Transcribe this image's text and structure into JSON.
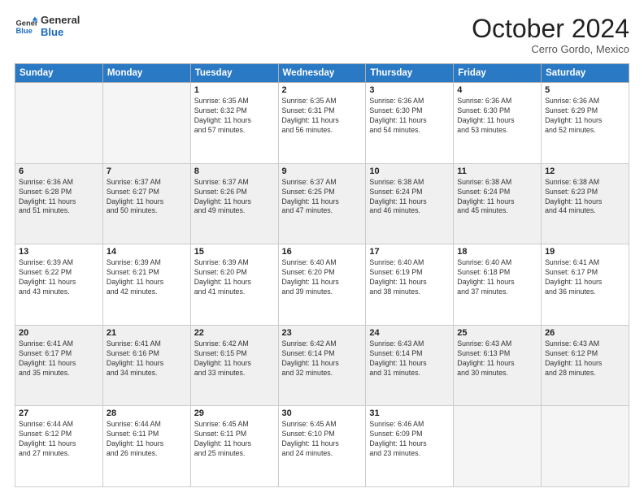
{
  "logo": {
    "line1": "General",
    "line2": "Blue"
  },
  "title": "October 2024",
  "location": "Cerro Gordo, Mexico",
  "days_of_week": [
    "Sunday",
    "Monday",
    "Tuesday",
    "Wednesday",
    "Thursday",
    "Friday",
    "Saturday"
  ],
  "weeks": [
    [
      {
        "num": "",
        "sunrise": "",
        "sunset": "",
        "daylight": ""
      },
      {
        "num": "",
        "sunrise": "",
        "sunset": "",
        "daylight": ""
      },
      {
        "num": "1",
        "sunrise": "Sunrise: 6:35 AM",
        "sunset": "Sunset: 6:32 PM",
        "daylight": "Daylight: 11 hours and 57 minutes."
      },
      {
        "num": "2",
        "sunrise": "Sunrise: 6:35 AM",
        "sunset": "Sunset: 6:31 PM",
        "daylight": "Daylight: 11 hours and 56 minutes."
      },
      {
        "num": "3",
        "sunrise": "Sunrise: 6:36 AM",
        "sunset": "Sunset: 6:30 PM",
        "daylight": "Daylight: 11 hours and 54 minutes."
      },
      {
        "num": "4",
        "sunrise": "Sunrise: 6:36 AM",
        "sunset": "Sunset: 6:30 PM",
        "daylight": "Daylight: 11 hours and 53 minutes."
      },
      {
        "num": "5",
        "sunrise": "Sunrise: 6:36 AM",
        "sunset": "Sunset: 6:29 PM",
        "daylight": "Daylight: 11 hours and 52 minutes."
      }
    ],
    [
      {
        "num": "6",
        "sunrise": "Sunrise: 6:36 AM",
        "sunset": "Sunset: 6:28 PM",
        "daylight": "Daylight: 11 hours and 51 minutes."
      },
      {
        "num": "7",
        "sunrise": "Sunrise: 6:37 AM",
        "sunset": "Sunset: 6:27 PM",
        "daylight": "Daylight: 11 hours and 50 minutes."
      },
      {
        "num": "8",
        "sunrise": "Sunrise: 6:37 AM",
        "sunset": "Sunset: 6:26 PM",
        "daylight": "Daylight: 11 hours and 49 minutes."
      },
      {
        "num": "9",
        "sunrise": "Sunrise: 6:37 AM",
        "sunset": "Sunset: 6:25 PM",
        "daylight": "Daylight: 11 hours and 47 minutes."
      },
      {
        "num": "10",
        "sunrise": "Sunrise: 6:38 AM",
        "sunset": "Sunset: 6:24 PM",
        "daylight": "Daylight: 11 hours and 46 minutes."
      },
      {
        "num": "11",
        "sunrise": "Sunrise: 6:38 AM",
        "sunset": "Sunset: 6:24 PM",
        "daylight": "Daylight: 11 hours and 45 minutes."
      },
      {
        "num": "12",
        "sunrise": "Sunrise: 6:38 AM",
        "sunset": "Sunset: 6:23 PM",
        "daylight": "Daylight: 11 hours and 44 minutes."
      }
    ],
    [
      {
        "num": "13",
        "sunrise": "Sunrise: 6:39 AM",
        "sunset": "Sunset: 6:22 PM",
        "daylight": "Daylight: 11 hours and 43 minutes."
      },
      {
        "num": "14",
        "sunrise": "Sunrise: 6:39 AM",
        "sunset": "Sunset: 6:21 PM",
        "daylight": "Daylight: 11 hours and 42 minutes."
      },
      {
        "num": "15",
        "sunrise": "Sunrise: 6:39 AM",
        "sunset": "Sunset: 6:20 PM",
        "daylight": "Daylight: 11 hours and 41 minutes."
      },
      {
        "num": "16",
        "sunrise": "Sunrise: 6:40 AM",
        "sunset": "Sunset: 6:20 PM",
        "daylight": "Daylight: 11 hours and 39 minutes."
      },
      {
        "num": "17",
        "sunrise": "Sunrise: 6:40 AM",
        "sunset": "Sunset: 6:19 PM",
        "daylight": "Daylight: 11 hours and 38 minutes."
      },
      {
        "num": "18",
        "sunrise": "Sunrise: 6:40 AM",
        "sunset": "Sunset: 6:18 PM",
        "daylight": "Daylight: 11 hours and 37 minutes."
      },
      {
        "num": "19",
        "sunrise": "Sunrise: 6:41 AM",
        "sunset": "Sunset: 6:17 PM",
        "daylight": "Daylight: 11 hours and 36 minutes."
      }
    ],
    [
      {
        "num": "20",
        "sunrise": "Sunrise: 6:41 AM",
        "sunset": "Sunset: 6:17 PM",
        "daylight": "Daylight: 11 hours and 35 minutes."
      },
      {
        "num": "21",
        "sunrise": "Sunrise: 6:41 AM",
        "sunset": "Sunset: 6:16 PM",
        "daylight": "Daylight: 11 hours and 34 minutes."
      },
      {
        "num": "22",
        "sunrise": "Sunrise: 6:42 AM",
        "sunset": "Sunset: 6:15 PM",
        "daylight": "Daylight: 11 hours and 33 minutes."
      },
      {
        "num": "23",
        "sunrise": "Sunrise: 6:42 AM",
        "sunset": "Sunset: 6:14 PM",
        "daylight": "Daylight: 11 hours and 32 minutes."
      },
      {
        "num": "24",
        "sunrise": "Sunrise: 6:43 AM",
        "sunset": "Sunset: 6:14 PM",
        "daylight": "Daylight: 11 hours and 31 minutes."
      },
      {
        "num": "25",
        "sunrise": "Sunrise: 6:43 AM",
        "sunset": "Sunset: 6:13 PM",
        "daylight": "Daylight: 11 hours and 30 minutes."
      },
      {
        "num": "26",
        "sunrise": "Sunrise: 6:43 AM",
        "sunset": "Sunset: 6:12 PM",
        "daylight": "Daylight: 11 hours and 28 minutes."
      }
    ],
    [
      {
        "num": "27",
        "sunrise": "Sunrise: 6:44 AM",
        "sunset": "Sunset: 6:12 PM",
        "daylight": "Daylight: 11 hours and 27 minutes."
      },
      {
        "num": "28",
        "sunrise": "Sunrise: 6:44 AM",
        "sunset": "Sunset: 6:11 PM",
        "daylight": "Daylight: 11 hours and 26 minutes."
      },
      {
        "num": "29",
        "sunrise": "Sunrise: 6:45 AM",
        "sunset": "Sunset: 6:11 PM",
        "daylight": "Daylight: 11 hours and 25 minutes."
      },
      {
        "num": "30",
        "sunrise": "Sunrise: 6:45 AM",
        "sunset": "Sunset: 6:10 PM",
        "daylight": "Daylight: 11 hours and 24 minutes."
      },
      {
        "num": "31",
        "sunrise": "Sunrise: 6:46 AM",
        "sunset": "Sunset: 6:09 PM",
        "daylight": "Daylight: 11 hours and 23 minutes."
      },
      {
        "num": "",
        "sunrise": "",
        "sunset": "",
        "daylight": ""
      },
      {
        "num": "",
        "sunrise": "",
        "sunset": "",
        "daylight": ""
      }
    ]
  ]
}
